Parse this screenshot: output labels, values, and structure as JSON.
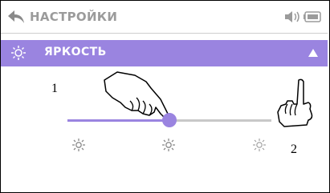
{
  "header": {
    "title": "НАСТРОЙКИ",
    "icons": [
      "back-arrow-icon",
      "sound-icon",
      "battery-icon"
    ]
  },
  "menu": {
    "selected_item": {
      "label": "ЯРКОСТЬ",
      "icon": "sun-icon",
      "expander": "up-arrow-icon"
    }
  },
  "brightness_slider": {
    "value_fraction": 0.5,
    "scale_icons": [
      "sun-icon",
      "sun-icon",
      "sun-icon"
    ]
  },
  "callouts": {
    "one": "1",
    "two": "2"
  },
  "colors": {
    "accent": "#9a84e0",
    "track": "#c8c8c8",
    "title": "#9b9b9b"
  }
}
